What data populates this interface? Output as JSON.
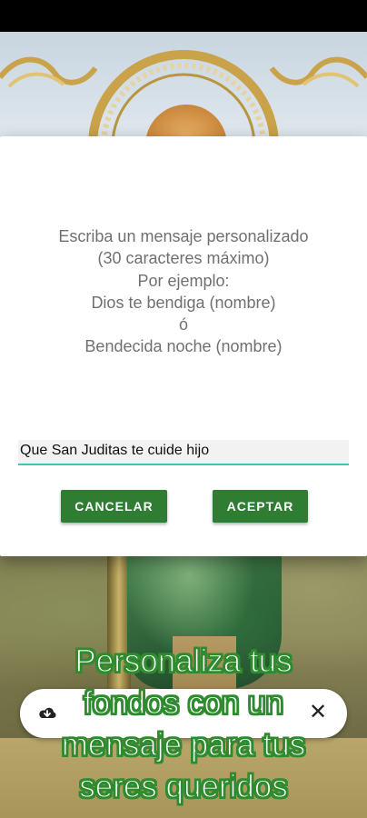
{
  "dialog": {
    "message_lines": [
      "Escriba un mensaje personalizado",
      "(30 caracteres máximo)",
      "Por ejemplo:",
      "Dios te bendiga (nombre)",
      "ó",
      "Bendecida noche (nombre)"
    ],
    "input_value": "Que San Juditas te cuide hijo",
    "cancel_label": "CANCELAR",
    "accept_label": "ACEPTAR"
  },
  "promo": {
    "lines": [
      "Personaliza tus",
      "fondos con un",
      "mensaje para tus",
      "seres queridos"
    ]
  },
  "icons": {
    "download": "download-cloud-icon",
    "close": "close-icon"
  },
  "colors": {
    "accent": "#2e7d32",
    "input_underline": "#3fc4b3",
    "promo_outline": "#2e8b2e"
  }
}
